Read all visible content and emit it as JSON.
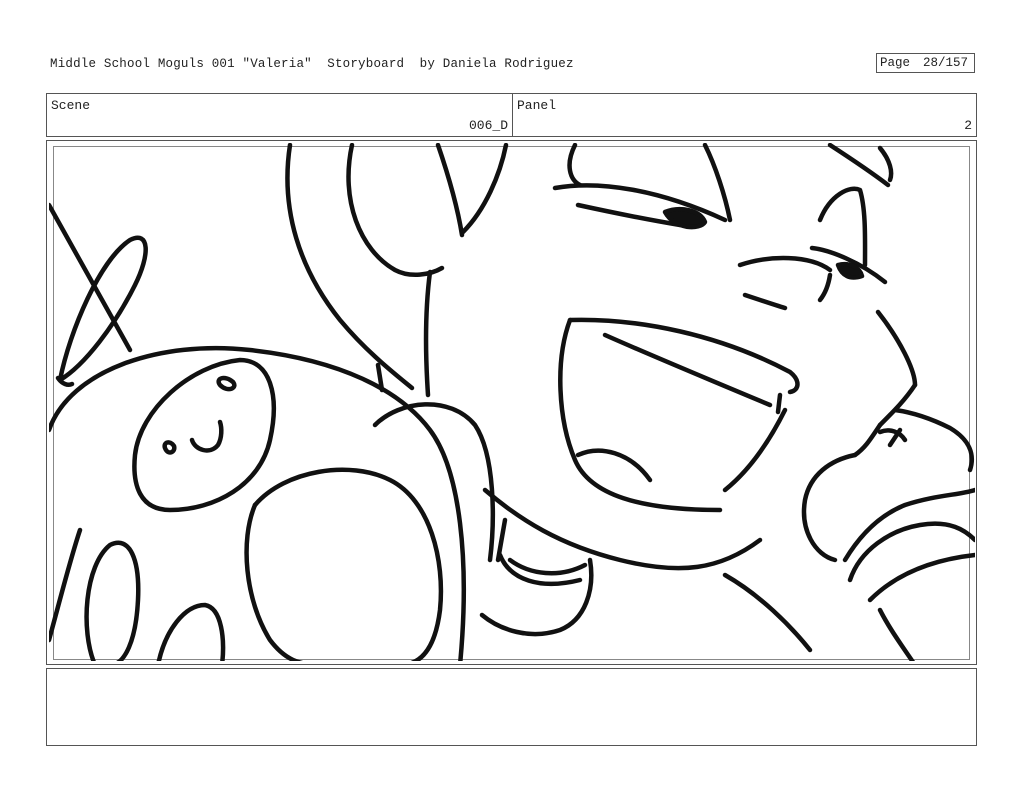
{
  "header": {
    "title": "Middle School Moguls 001 \"Valeria\"  Storyboard  by Daniela Rodriguez",
    "page_label": "Page",
    "page_number": "28/157"
  },
  "scene": {
    "label": "Scene",
    "value": "006_D"
  },
  "panel": {
    "label": "Panel",
    "value": "2"
  },
  "frame": {
    "drawing": "storyboard-sketch"
  },
  "notes": {
    "text": ""
  }
}
